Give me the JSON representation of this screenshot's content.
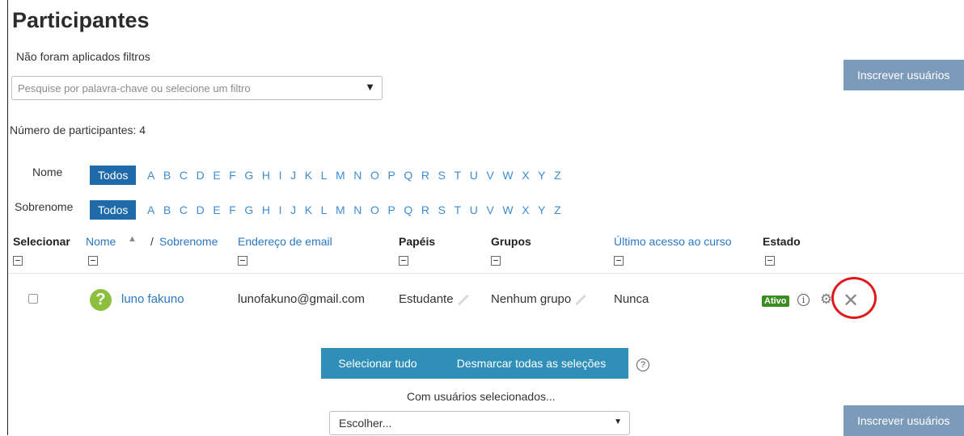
{
  "page": {
    "title": "Participantes",
    "filters_status": "Não foram aplicados filtros",
    "search_placeholder": "Pesquise por palavra-chave ou selecione um filtro",
    "enroll_button": "Inscrever usuários",
    "participant_count": "Número de participantes: 4"
  },
  "initials": {
    "first_label": "Nome",
    "last_label": "Sobrenome",
    "all_label": "Todos",
    "letters": [
      "A",
      "B",
      "C",
      "D",
      "E",
      "F",
      "G",
      "H",
      "I",
      "J",
      "K",
      "L",
      "M",
      "N",
      "O",
      "P",
      "Q",
      "R",
      "S",
      "T",
      "U",
      "V",
      "W",
      "X",
      "Y",
      "Z"
    ]
  },
  "table": {
    "headers": {
      "select": "Selecionar",
      "name": "Nome",
      "separator": "/",
      "surname": "Sobrenome",
      "email": "Endereço de email",
      "roles": "Papéis",
      "groups": "Grupos",
      "last_access": "Último acesso ao curso",
      "status": "Estado"
    },
    "rows": [
      {
        "name": "luno fakuno",
        "email": "lunofakuno@gmail.com",
        "role": "Estudante",
        "group": "Nenhum grupo",
        "last_access": "Nunca",
        "status": "Ativo"
      }
    ]
  },
  "actions": {
    "select_all": "Selecionar tudo",
    "deselect_all": "Desmarcar todas as seleções",
    "with_selected": "Com usuários selecionados...",
    "choose": "Escolher..."
  },
  "colors": {
    "primary": "#1f6aa8",
    "link": "#2a78c2",
    "button_teal": "#2f8fb8",
    "enroll_button": "#7c9bbb",
    "active_badge": "#3d8c22",
    "annotation_circle": "#e01a1a"
  },
  "icons": [
    "sort-asc-icon",
    "collapse-icon",
    "question-avatar-icon",
    "edit-pencil-icon",
    "info-icon",
    "gear-icon",
    "close-icon",
    "help-icon",
    "dropdown-caret-icon"
  ]
}
